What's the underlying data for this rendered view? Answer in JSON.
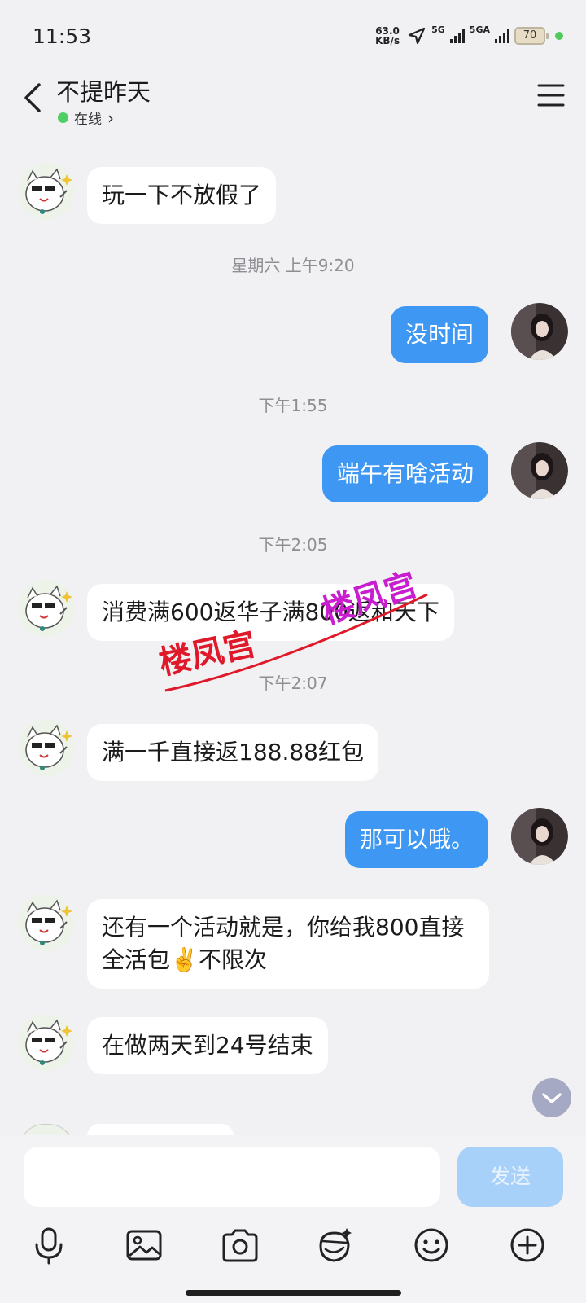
{
  "status_bar": {
    "time": "11:53",
    "net_speed_value": "63.0",
    "net_speed_unit": "KB/s",
    "sim1_label": "5G",
    "sim2_label": "5GA",
    "battery": "70"
  },
  "header": {
    "contact_name": "不提昨天",
    "online_status": "在线",
    "chevron": "›"
  },
  "messages": [
    {
      "side": "left",
      "text": "玩一下不放假了"
    },
    {
      "side": "time",
      "text": "星期六 上午9:20"
    },
    {
      "side": "right",
      "text": "没时间"
    },
    {
      "side": "time",
      "text": "下午1:55"
    },
    {
      "side": "right",
      "text": "端午有啥活动"
    },
    {
      "side": "time",
      "text": "下午2:05"
    },
    {
      "side": "left",
      "text": "消费满600返华子满800返和天下"
    },
    {
      "side": "time",
      "text": "下午2:07"
    },
    {
      "side": "left",
      "text": "满一千直接返188.88红包"
    },
    {
      "side": "right",
      "text": "那可以哦。"
    },
    {
      "side": "left",
      "text": "还有一个活动就是，你给我800直接全活包✌️不限次"
    },
    {
      "side": "left",
      "text": "在做两天到24号结束"
    }
  ],
  "watermark": {
    "text": "楼凤宫",
    "color_red": "#e0192a",
    "color_magenta": "#c81ed0"
  },
  "input": {
    "placeholder": "",
    "send_label": "发送"
  },
  "toolbar": {
    "icons": [
      "microphone-icon",
      "image-icon",
      "camera-icon",
      "sticker-icon",
      "emoji-icon",
      "plus-icon"
    ]
  },
  "colors": {
    "accent_blue": "#3d97f3",
    "online_green": "#4fcf63",
    "send_disabled": "#a8d1fa"
  }
}
